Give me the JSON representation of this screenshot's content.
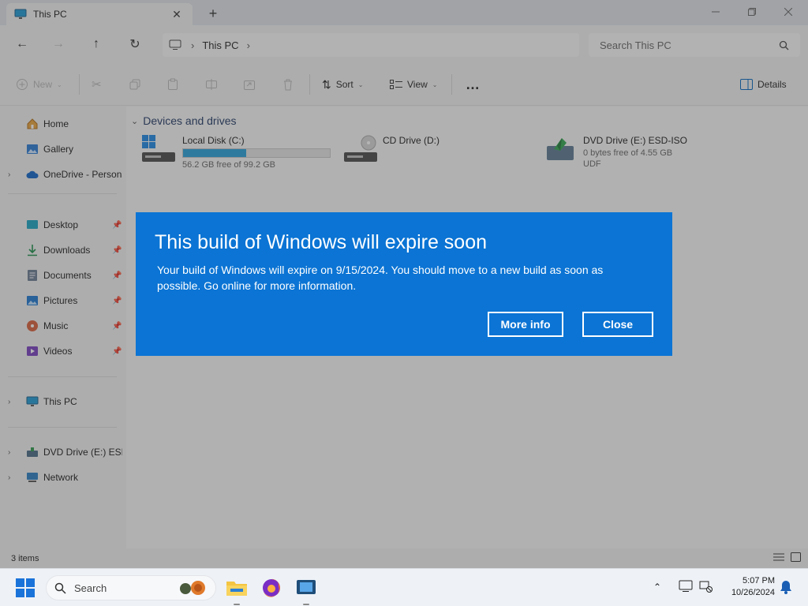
{
  "window": {
    "tab_title": "This PC",
    "tab_icon": "monitor-icon",
    "new_tab": "+",
    "controls": {
      "minimize": "—",
      "maximize": "❐",
      "close": "✕"
    }
  },
  "nav": {
    "back": "←",
    "forward": "→",
    "up": "↑",
    "refresh": "↻",
    "breadcrumb": [
      "This PC"
    ],
    "search_placeholder": "Search This PC"
  },
  "commands": {
    "new": "New",
    "sort": "Sort",
    "view": "View",
    "more": "…",
    "details": "Details"
  },
  "sidebar": {
    "items": [
      {
        "label": "Home",
        "icon": "home-icon"
      },
      {
        "label": "Gallery",
        "icon": "gallery-icon"
      },
      {
        "label": "OneDrive - Persona",
        "icon": "cloud-icon"
      },
      {
        "label": "Desktop",
        "icon": "desktop-icon"
      },
      {
        "label": "Downloads",
        "icon": "download-icon"
      },
      {
        "label": "Documents",
        "icon": "documents-icon"
      },
      {
        "label": "Pictures",
        "icon": "pictures-icon"
      },
      {
        "label": "Music",
        "icon": "music-icon"
      },
      {
        "label": "Videos",
        "icon": "videos-icon"
      },
      {
        "label": "This PC",
        "icon": "monitor-icon"
      },
      {
        "label": "DVD Drive (E:) ESD-",
        "icon": "dvd-icon"
      },
      {
        "label": "Network",
        "icon": "network-icon"
      }
    ]
  },
  "content": {
    "group_header": "Devices and drives",
    "drives": [
      {
        "name": "Local Disk (C:)",
        "detail": "56.2 GB free of 99.2 GB",
        "used_fraction": 0.43
      },
      {
        "name": "CD Drive (D:)"
      },
      {
        "name": "DVD Drive (E:) ESD-ISO",
        "detail": "0 bytes free of 4.55 GB",
        "detail2": "UDF"
      }
    ]
  },
  "dialog": {
    "title": "This build of Windows will expire soon",
    "body": "Your build of Windows will expire on 9/15/2024. You should move to a new build as soon as possible. Go online for more information.",
    "more_info": "More info",
    "close": "Close"
  },
  "status": {
    "item_count": "3 items"
  },
  "taskbar": {
    "search_placeholder": "Search",
    "time": "5:07 PM",
    "date": "10/26/2024"
  },
  "colors": {
    "dialog_bg": "#0b74d4",
    "accent": "#0067c0",
    "drive_bar": "#26a0da"
  }
}
